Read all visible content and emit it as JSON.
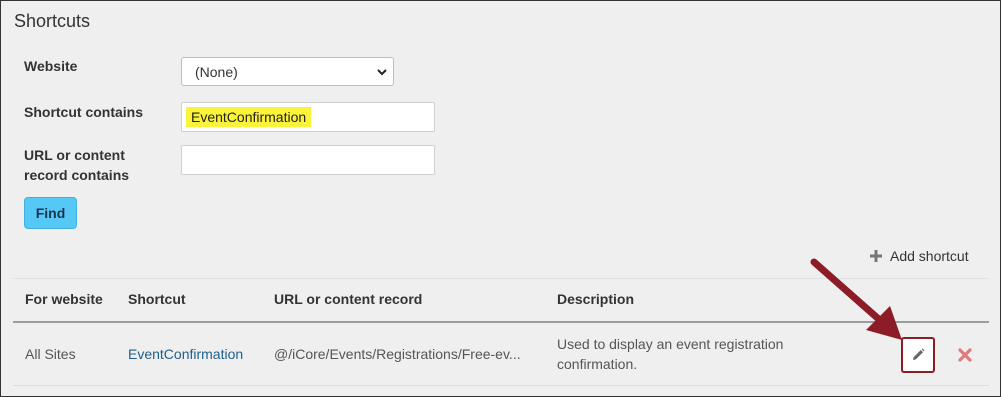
{
  "page_title": "Shortcuts",
  "filters": {
    "website_label": "Website",
    "website_selected": "(None)",
    "shortcut_label": "Shortcut contains",
    "shortcut_value": "EventConfirmation",
    "url_label": "URL or content record contains",
    "url_value": ""
  },
  "find_button": "Find",
  "add_shortcut_label": "Add shortcut",
  "table": {
    "headers": [
      "For website",
      "Shortcut",
      "URL or content record",
      "Description"
    ],
    "rows": [
      {
        "website": "All Sites",
        "shortcut": "EventConfirmation",
        "url": "@/iCore/Events/Registrations/Free-ev...",
        "description": "Used to display an event registration confirmation."
      }
    ]
  },
  "colors": {
    "highlight": "#fbf339",
    "find_button": "#56c8f5",
    "annotation": "#8c1c25",
    "delete": "#e07a7a"
  },
  "icons": [
    "chevron-down-icon",
    "plus-icon",
    "pencil-icon",
    "delete-x-icon"
  ]
}
